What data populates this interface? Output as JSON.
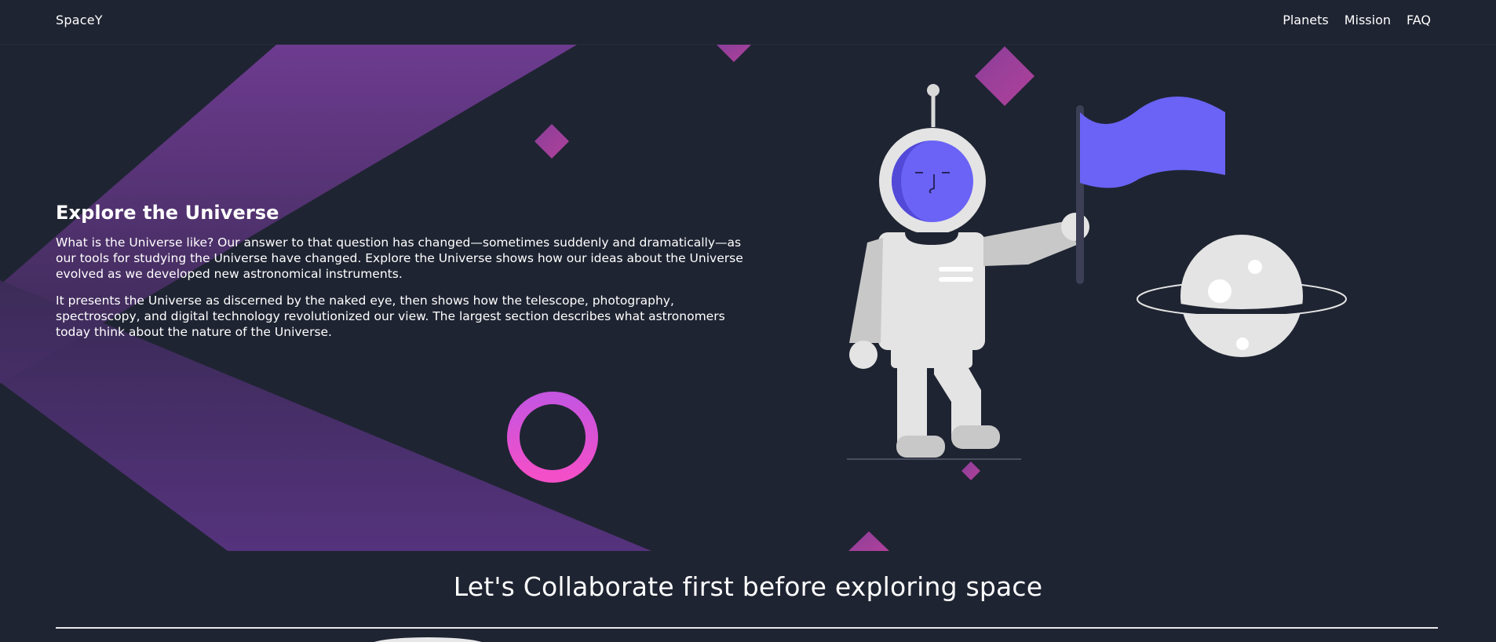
{
  "navbar": {
    "brand": "SpaceY",
    "links": [
      "Planets",
      "Mission",
      "FAQ"
    ]
  },
  "hero": {
    "title": "Explore the Universe",
    "paragraphs": [
      "What is the Universe like? Our answer to that question has changed—sometimes suddenly and dramatically—as our tools for studying the Universe have changed. Explore the Universe shows how our ideas about the Universe evolved as we developed new astronomical instruments.",
      "It presents the Universe as discerned by the naked eye, then shows how the telescope, photography, spectroscopy, and digital technology revolutionized our view. The largest section describes what astronomers today think about the nature of the Universe."
    ]
  },
  "collaborate": {
    "title": "Let's Collaborate first before exploring space"
  },
  "colors": {
    "background": "#1f2432",
    "purple_gradient_start": "#7b3fa0",
    "pink_ring": "#e84fd0",
    "flag": "#6a63f6",
    "astronaut": "#e4e4e4"
  },
  "icons": {
    "astronaut": "astronaut-illustration",
    "planet": "ringed-planet-illustration",
    "ring": "ring-shape",
    "diamonds": "diamond-shapes"
  }
}
